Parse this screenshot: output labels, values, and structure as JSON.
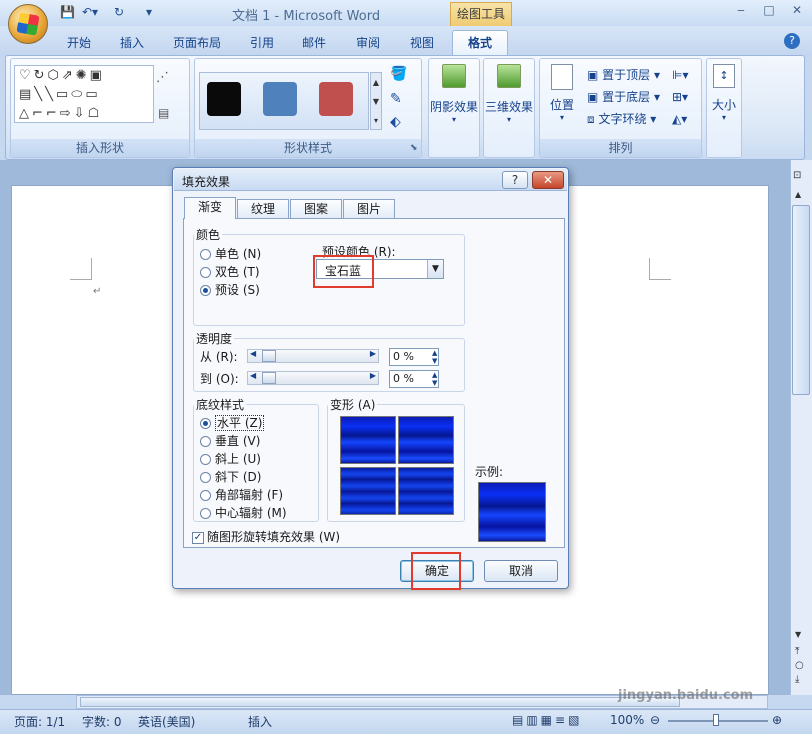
{
  "window": {
    "title": "文档 1 - Microsoft Word",
    "contextual_tab_group": "绘图工具",
    "controls": [
      "‒",
      "□",
      "✕"
    ]
  },
  "ribbon": {
    "tabs": [
      "开始",
      "插入",
      "页面布局",
      "引用",
      "邮件",
      "审阅",
      "视图",
      "格式"
    ],
    "active_tab": "格式",
    "groups": {
      "insert_shapes": "插入形状",
      "shape_styles": "形状样式",
      "shadow": "阴影效果",
      "threed": "三维效果",
      "arrange": "排列",
      "size": "大小"
    },
    "arrange_items": [
      "置于顶层",
      "置于底层",
      "文字环绕"
    ],
    "position_label": "位置",
    "size_label": "大小",
    "style_swatches": [
      "#0a0a0a",
      "#4f81bd",
      "#c0504d"
    ]
  },
  "dialog": {
    "title": "填充效果",
    "help": "?",
    "close": "✕",
    "tabs": [
      "渐变",
      "纹理",
      "图案",
      "图片"
    ],
    "active_tab": "渐变",
    "color_section": {
      "legend": "颜色",
      "options": [
        "单色 (N)",
        "双色 (T)",
        "预设 (S)"
      ],
      "selected": "预设 (S)",
      "preset_label": "预设颜色 (R):",
      "preset_value": "宝石蓝"
    },
    "transparency": {
      "legend": "透明度",
      "from_label": "从 (R):",
      "to_label": "到 (O):",
      "from_value": "0 %",
      "to_value": "0 %"
    },
    "shading": {
      "legend": "底纹样式",
      "options": [
        "水平 (Z)",
        "垂直 (V)",
        "斜上 (U)",
        "斜下 (D)",
        "角部辐射 (F)",
        "中心辐射 (M)"
      ],
      "selected": "水平 (Z)"
    },
    "variants_legend": "变形 (A)",
    "sample_label": "示例:",
    "rotate_checkbox": "随图形旋转填充效果 (W)",
    "rotate_checked": true,
    "ok": "确定",
    "cancel": "取消"
  },
  "status": {
    "page": "页面: 1/1",
    "words": "字数: 0",
    "language": "英语(美国)",
    "mode": "插入",
    "zoom": "100%"
  },
  "watermark": "jingyan.baidu.com"
}
